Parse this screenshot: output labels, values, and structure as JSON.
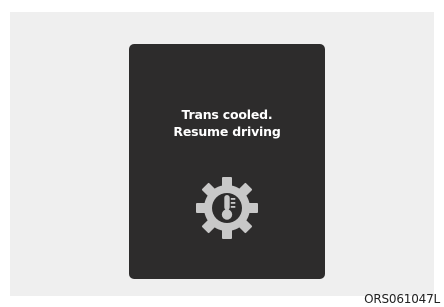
{
  "display": {
    "message_line1": "Trans cooled.",
    "message_line2": "Resume driving",
    "icon": "transmission-temperature-gear-icon"
  },
  "figure": {
    "code": "ORS061047L"
  },
  "colors": {
    "display_background": "#2d2c2c",
    "panel_background": "#efefef",
    "icon_color": "#c8c8c8",
    "text_color": "#ffffff"
  }
}
